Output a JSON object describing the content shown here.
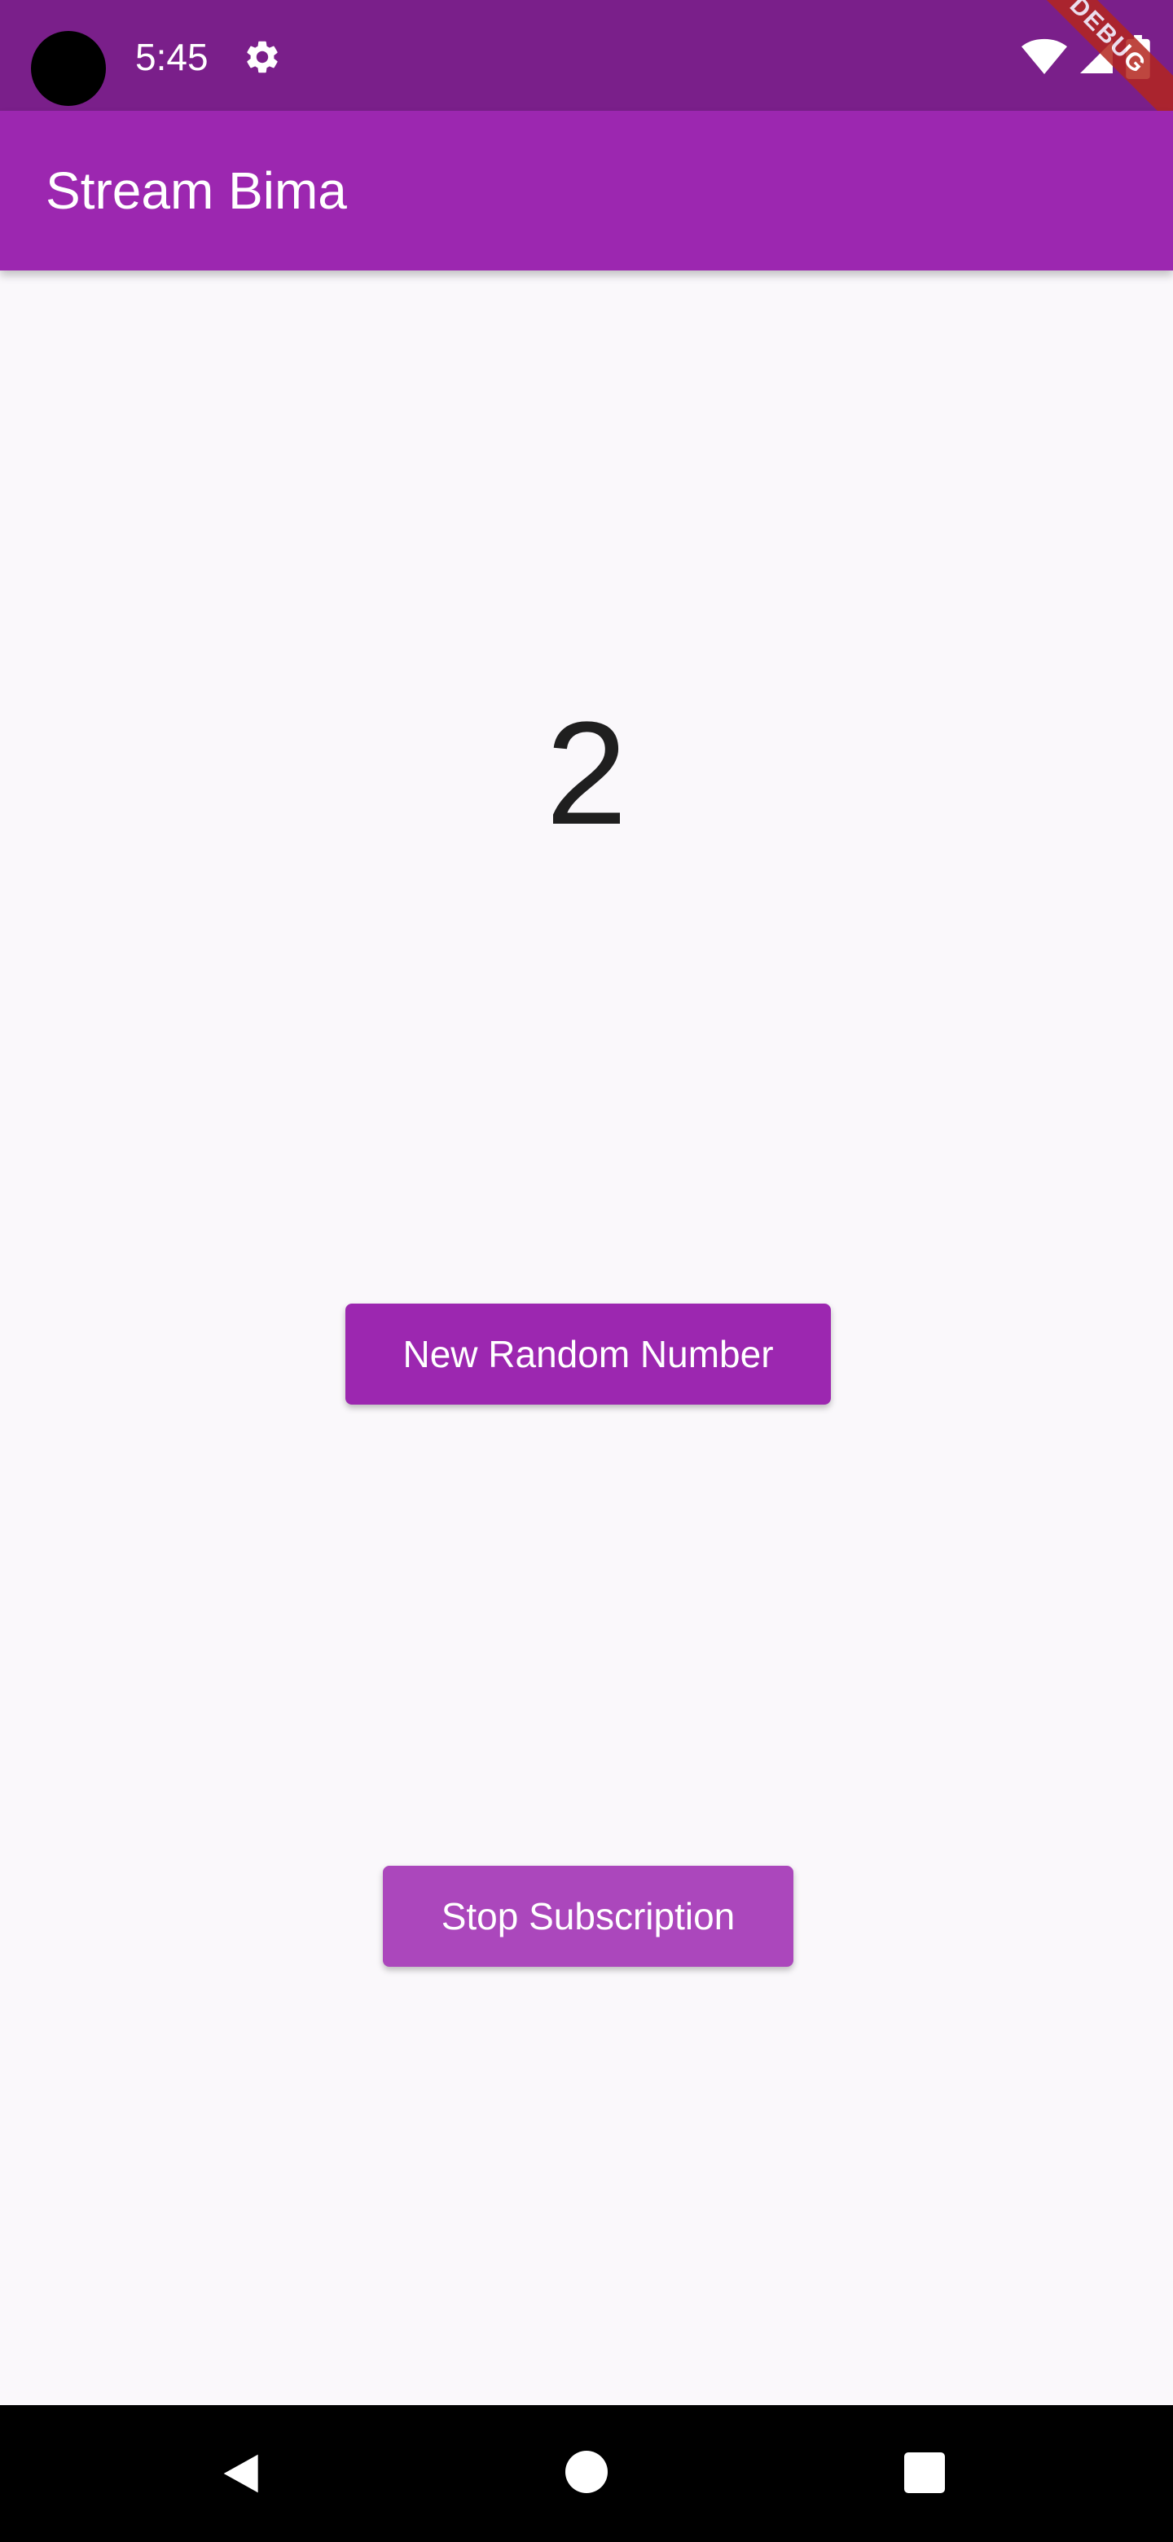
{
  "status_bar": {
    "time": "5:45",
    "icons": [
      "settings-icon",
      "wifi-icon",
      "cellular-icon",
      "battery-icon"
    ],
    "debug_banner": "DEBUG"
  },
  "app_bar": {
    "title": "Stream Bima",
    "color": "#9c27b0"
  },
  "main": {
    "number": "2",
    "new_random_button_label": "New Random Number",
    "stop_subscription_button_label": "Stop Subscription"
  },
  "nav_bar": {
    "icons": [
      "back-icon",
      "home-icon",
      "recents-icon"
    ]
  },
  "colors": {
    "status_bar": "#7a1f8a",
    "primary": "#9c27b0",
    "stop_button": "#ab47bc",
    "background": "#faf8fb"
  }
}
